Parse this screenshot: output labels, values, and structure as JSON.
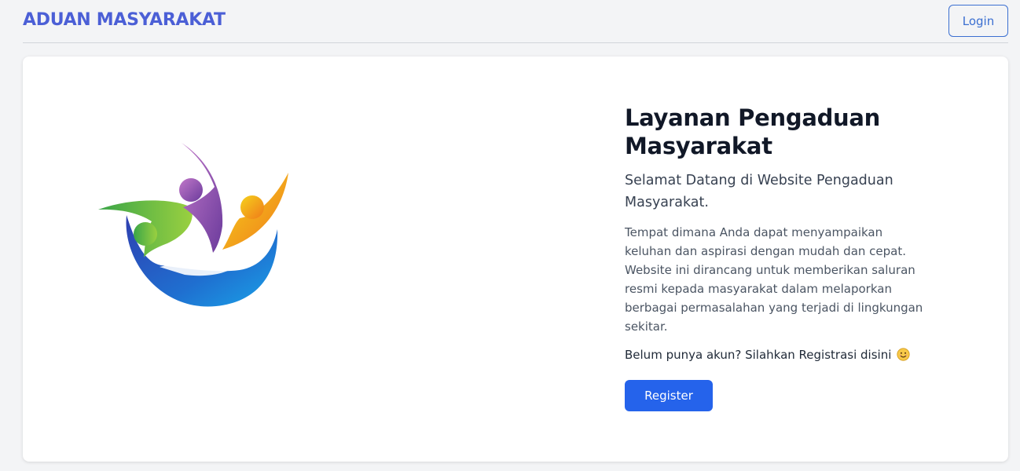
{
  "navbar": {
    "brand": "ADUAN MASYARAKAT",
    "login_label": "Login"
  },
  "hero": {
    "title": "Layanan Pengaduan Masyarakat",
    "subtitle": "Selamat Datang di Website Pengaduan Masyarakat.",
    "description": "Tempat dimana Anda dapat menyampaikan keluhan dan aspirasi dengan mudah dan cepat. Website ini dirancang untuk memberikan saluran resmi kepada masyarakat dalam melaporkan berbagai permasalahan yang terjadi di lingkungan sekitar.",
    "register_prompt": "Belum punya akun? Silahkan Registrasi disini",
    "register_emoji": "smiling-face-icon",
    "register_label": "Register"
  },
  "colors": {
    "brand": "#4b5fd6",
    "primary_button": "#2563eb",
    "outline_button": "#3b6fd1",
    "page_background": "#f3f4f6"
  },
  "logo": {
    "icon": "community-hands-logo"
  }
}
